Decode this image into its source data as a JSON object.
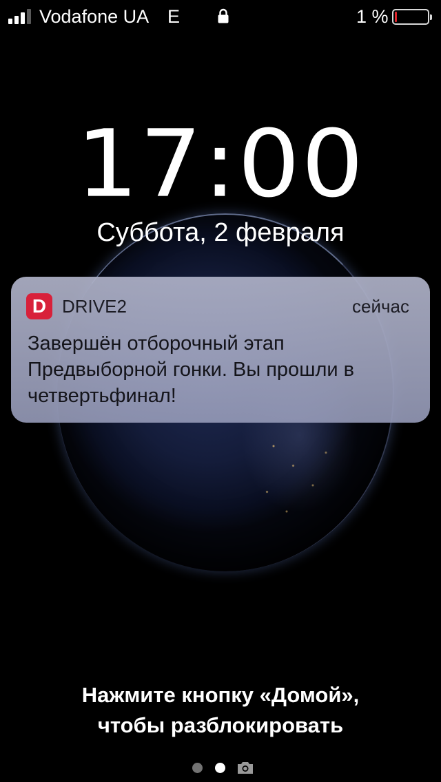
{
  "status_bar": {
    "carrier": "Vodafone UA",
    "network": "E",
    "battery_percent_label": "1 %",
    "battery_level": 0.01,
    "battery_color": "#e0242b",
    "signal_bars_filled": 3,
    "signal_bars_total": 4
  },
  "lock_screen": {
    "time": "17:00",
    "date": "Суббота, 2 февраля",
    "unlock_hint_line1": "Нажмите кнопку «Домой»,",
    "unlock_hint_line2": "чтобы разблокировать"
  },
  "notification": {
    "app_icon_letter": "D",
    "app_icon_color": "#d8213a",
    "app_name": "DRIVE2",
    "time": "сейчас",
    "message": "Завершён отборочный этап Предвыборной гонки. Вы прошли в четвертьфинал!"
  },
  "page_indicator": {
    "pages": 2,
    "active_page": 2,
    "trailing_icon": "camera-icon"
  }
}
